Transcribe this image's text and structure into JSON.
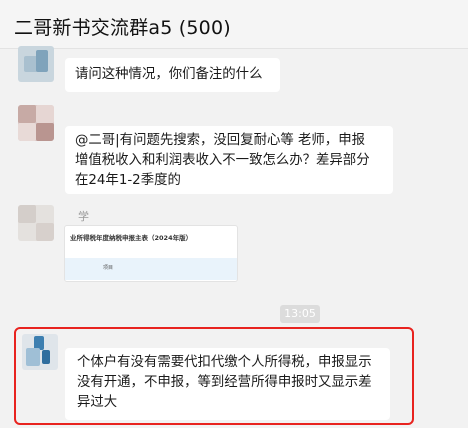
{
  "window": {
    "title": "二哥新书交流群a5 (500)"
  },
  "messages": [
    {
      "id": "m1",
      "lines": [
        "请问这种情况，你们备注的什么"
      ]
    },
    {
      "id": "m2",
      "lines": [
        "@二哥|有问题先搜索，没回复耐心等 老师，申报",
        "增值税收入和利润表收入不一致怎么办？差异部分",
        "在24年1-2季度的"
      ]
    },
    {
      "id": "m3",
      "sender": "学",
      "attachment_title": "业所得税年度纳税申报主表（2024年版）",
      "attachment_cell": "项目"
    },
    {
      "id": "m4",
      "lines": [
        "个体户有没有需要代扣代缴个人所得税，申报显示",
        "没有开通，不申报，等到经营所得申报时又显示差",
        "异过大"
      ]
    }
  ],
  "timestamp": "13:05",
  "colors": {
    "highlight": "#e8231f",
    "bubble": "#ffffff",
    "background": "#f2f2f2"
  }
}
